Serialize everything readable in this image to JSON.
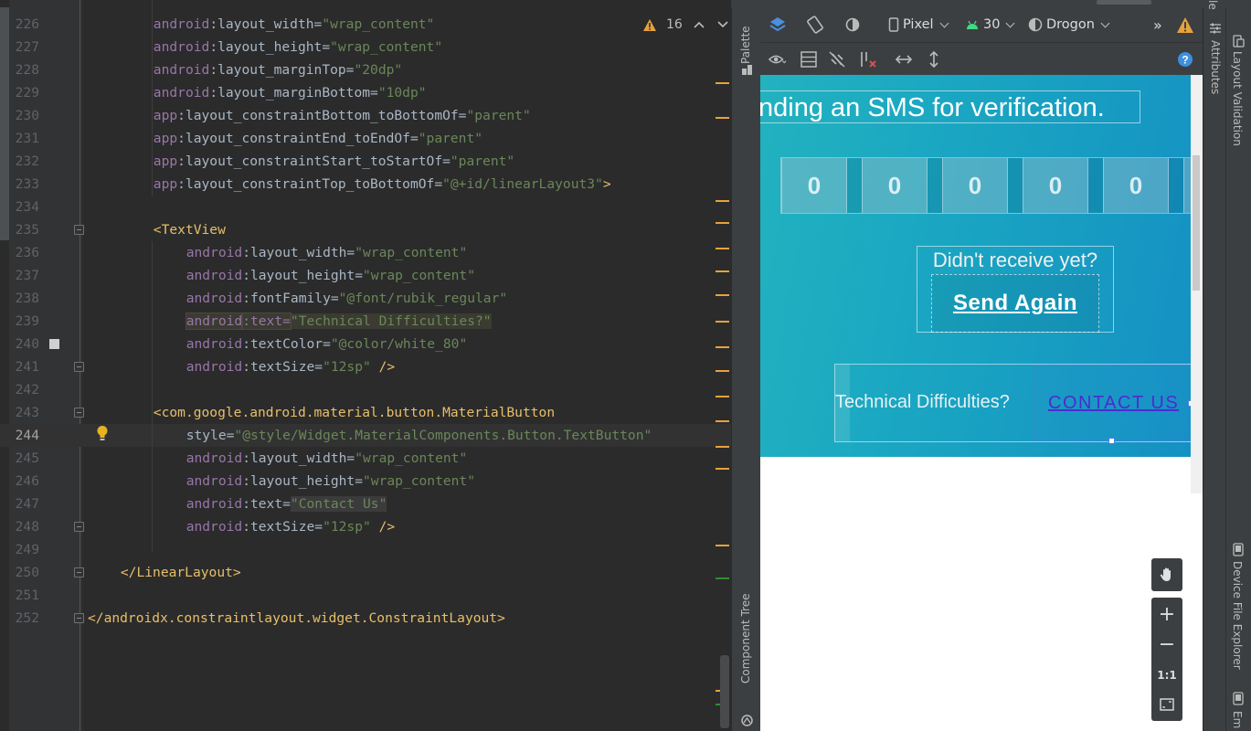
{
  "editor": {
    "warning_count": "16",
    "lines": [
      {
        "n": "226",
        "indent": 2,
        "tokens": [
          [
            "k",
            "android"
          ],
          [
            "p",
            ":layout_width="
          ],
          [
            "s",
            "\"wrap_content\""
          ]
        ]
      },
      {
        "n": "227",
        "indent": 2,
        "tokens": [
          [
            "k",
            "android"
          ],
          [
            "p",
            ":layout_height="
          ],
          [
            "s",
            "\"wrap_content\""
          ]
        ]
      },
      {
        "n": "228",
        "indent": 2,
        "tokens": [
          [
            "k",
            "android"
          ],
          [
            "p",
            ":layout_marginTop="
          ],
          [
            "s",
            "\"20dp\""
          ]
        ]
      },
      {
        "n": "229",
        "indent": 2,
        "tokens": [
          [
            "k",
            "android"
          ],
          [
            "p",
            ":layout_marginBottom="
          ],
          [
            "s",
            "\"10dp\""
          ]
        ]
      },
      {
        "n": "230",
        "indent": 2,
        "tokens": [
          [
            "k",
            "app"
          ],
          [
            "p",
            ":layout_constraintBottom_toBottomOf="
          ],
          [
            "s",
            "\"parent\""
          ]
        ]
      },
      {
        "n": "231",
        "indent": 2,
        "tokens": [
          [
            "k",
            "app"
          ],
          [
            "p",
            ":layout_constraintEnd_toEndOf="
          ],
          [
            "s",
            "\"parent\""
          ]
        ]
      },
      {
        "n": "232",
        "indent": 2,
        "tokens": [
          [
            "k",
            "app"
          ],
          [
            "p",
            ":layout_constraintStart_toStartOf="
          ],
          [
            "s",
            "\"parent\""
          ]
        ]
      },
      {
        "n": "233",
        "indent": 2,
        "tokens": [
          [
            "k",
            "app"
          ],
          [
            "p",
            ":layout_constraintTop_toBottomOf="
          ],
          [
            "s",
            "\"@+id/linearLayout3\""
          ],
          [
            "t",
            ">"
          ]
        ]
      },
      {
        "n": "234",
        "indent": 0,
        "tokens": []
      },
      {
        "n": "235",
        "indent": 2,
        "fold": true,
        "tokens": [
          [
            "t",
            "<TextView"
          ]
        ]
      },
      {
        "n": "236",
        "indent": 3,
        "tokens": [
          [
            "k",
            "android"
          ],
          [
            "p",
            ":layout_width="
          ],
          [
            "s",
            "\"wrap_content\""
          ]
        ]
      },
      {
        "n": "237",
        "indent": 3,
        "tokens": [
          [
            "k",
            "android"
          ],
          [
            "p",
            ":layout_height="
          ],
          [
            "s",
            "\"wrap_content\""
          ]
        ]
      },
      {
        "n": "238",
        "indent": 3,
        "tokens": [
          [
            "k",
            "android"
          ],
          [
            "p",
            ":fontFamily="
          ],
          [
            "s",
            "\"@font/rubik_regular\""
          ]
        ]
      },
      {
        "n": "239",
        "indent": 3,
        "highlight": "green",
        "tokens": [
          [
            "k",
            "android"
          ],
          [
            "p",
            ":text="
          ],
          [
            "s",
            "\"Technical Difficulties?\""
          ]
        ]
      },
      {
        "n": "240",
        "indent": 3,
        "tokens": [
          [
            "k",
            "android"
          ],
          [
            "p",
            ":textColor="
          ],
          [
            "s",
            "\"@color/white_80\""
          ]
        ]
      },
      {
        "n": "241",
        "indent": 3,
        "fold": true,
        "tokens": [
          [
            "k",
            "android"
          ],
          [
            "p",
            ":textSize="
          ],
          [
            "s",
            "\"12sp\""
          ],
          [
            "t",
            " />"
          ]
        ]
      },
      {
        "n": "242",
        "indent": 0,
        "tokens": []
      },
      {
        "n": "243",
        "indent": 2,
        "fold": true,
        "tokens": [
          [
            "t",
            "<com.google.android.material.button.MaterialButton"
          ]
        ]
      },
      {
        "n": "244",
        "indent": 3,
        "current": true,
        "tokens": [
          [
            "p",
            "style="
          ],
          [
            "s",
            "\"@style/Widget.MaterialComponents.Button.TextButton\""
          ]
        ]
      },
      {
        "n": "245",
        "indent": 3,
        "tokens": [
          [
            "k",
            "android"
          ],
          [
            "p",
            ":layout_width="
          ],
          [
            "s",
            "\"wrap_content\""
          ]
        ]
      },
      {
        "n": "246",
        "indent": 3,
        "tokens": [
          [
            "k",
            "android"
          ],
          [
            "p",
            ":layout_height="
          ],
          [
            "s",
            "\"wrap_content\""
          ]
        ]
      },
      {
        "n": "247",
        "indent": 3,
        "grey": true,
        "tokens": [
          [
            "k",
            "android"
          ],
          [
            "p",
            ":text="
          ],
          [
            "s",
            "\"Contact Us\""
          ]
        ]
      },
      {
        "n": "248",
        "indent": 3,
        "fold": true,
        "tokens": [
          [
            "k",
            "android"
          ],
          [
            "p",
            ":textSize="
          ],
          [
            "s",
            "\"12sp\""
          ],
          [
            "t",
            " />"
          ]
        ]
      },
      {
        "n": "249",
        "indent": 0,
        "tokens": []
      },
      {
        "n": "250",
        "indent": 1,
        "fold": true,
        "tokens": [
          [
            "t",
            "</LinearLayout>"
          ]
        ]
      },
      {
        "n": "251",
        "indent": 0,
        "tokens": []
      },
      {
        "n": "252",
        "indent": 0,
        "fold": true,
        "tokens": [
          [
            "t",
            "</androidx.constraintlayout.widget.ConstraintLayout>"
          ]
        ]
      }
    ]
  },
  "side_left": {
    "palette": "Palette",
    "component_tree": "Component Tree"
  },
  "side_right": {
    "attributes": "Attributes",
    "layout_validation": "Layout Validation",
    "device_file_explorer": "Device File Explorer",
    "top_cut": "le",
    "bottom_cut": "Em"
  },
  "design_toolbar": {
    "device": "Pixel",
    "api_level": "30",
    "theme": "Drogon",
    "overflow": "»"
  },
  "preview": {
    "sms_text": "nding an SMS for verification.",
    "digits": [
      "0",
      "0",
      "0",
      "0",
      "0"
    ],
    "didnt_receive": "Didn't receive yet?",
    "send_again": "Send Again",
    "technical": "Technical Difficulties?",
    "contact_us": "CONTACT US"
  },
  "zoom": {
    "zoom_in": "+",
    "zoom_out": "−",
    "actual_size": "1:1"
  },
  "colors": {
    "warning": "#e6a23c",
    "marker_ok": "#2f8f2f",
    "selection": "#4a7ee0"
  }
}
